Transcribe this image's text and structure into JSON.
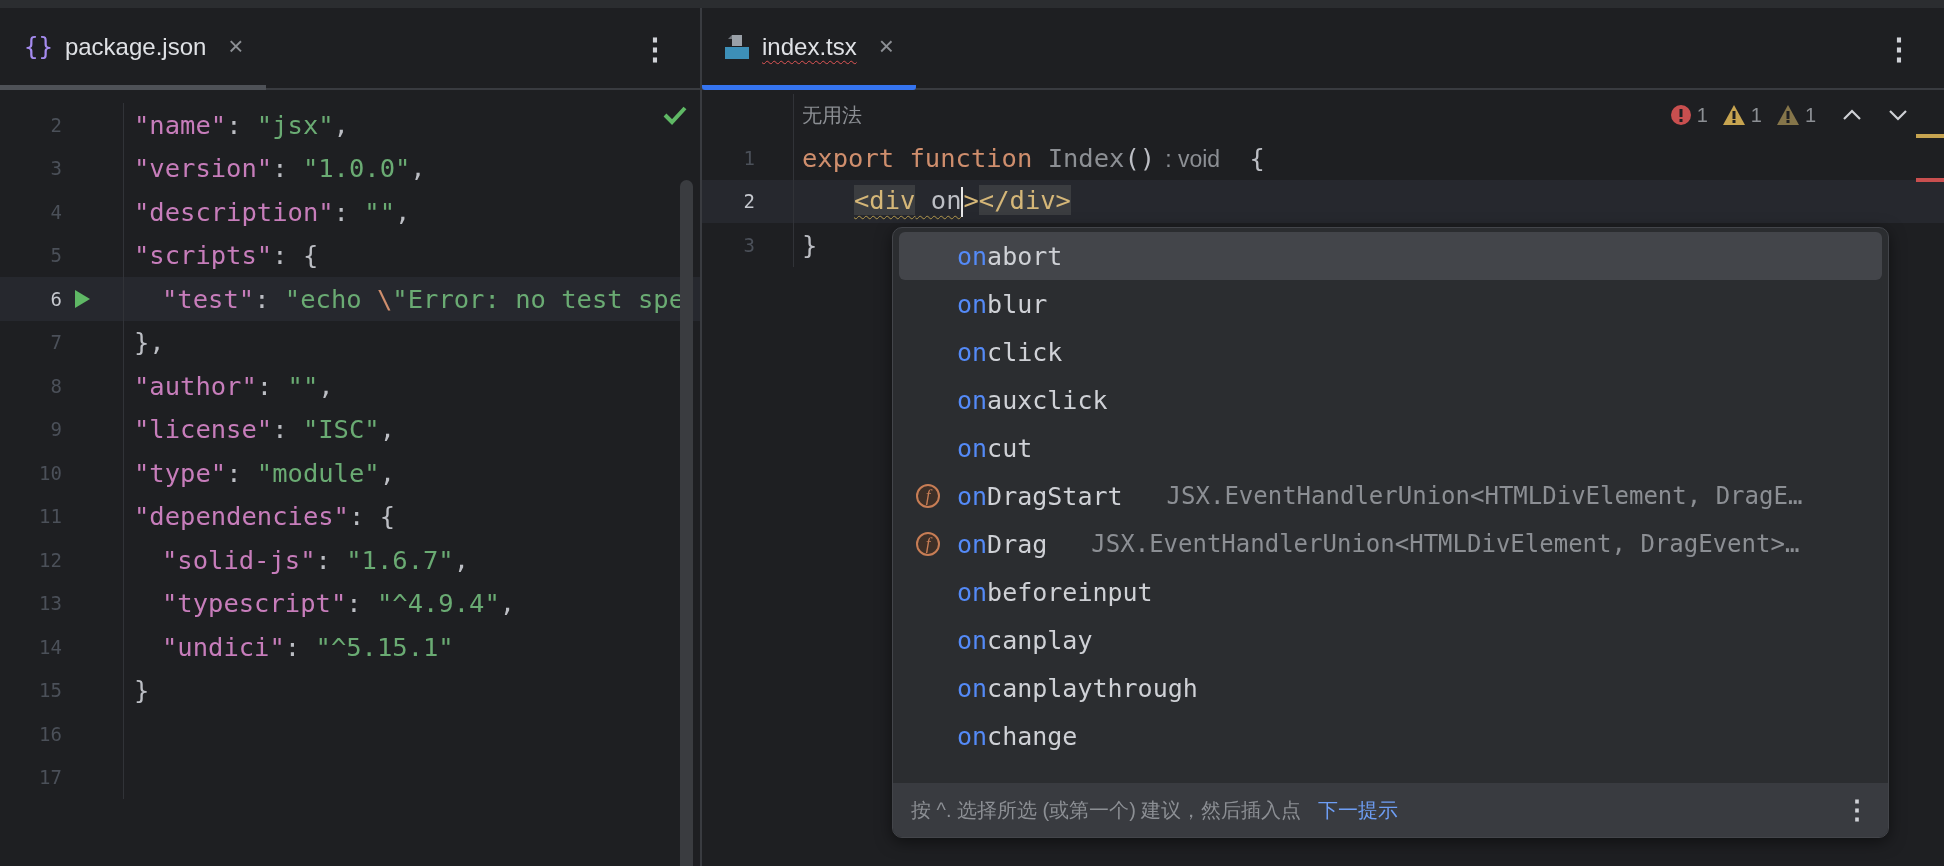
{
  "left_pane": {
    "tab": {
      "icon_text": "{}",
      "label": "package.json",
      "close": "×",
      "selected": false
    },
    "menu": "⋮",
    "lines": [
      {
        "number": "2",
        "current": false,
        "tokens": [
          {
            "kind": "key",
            "text": "\"name\""
          },
          {
            "kind": "punc",
            "text": ": "
          },
          {
            "kind": "str",
            "text": "\"jsx\""
          },
          {
            "kind": "punc",
            "text": ","
          }
        ]
      },
      {
        "number": "3",
        "current": false,
        "tokens": [
          {
            "kind": "key",
            "text": "\"version\""
          },
          {
            "kind": "punc",
            "text": ": "
          },
          {
            "kind": "str",
            "text": "\"1.0.0\""
          },
          {
            "kind": "punc",
            "text": ","
          }
        ]
      },
      {
        "number": "4",
        "current": false,
        "tokens": [
          {
            "kind": "key",
            "text": "\"description\""
          },
          {
            "kind": "punc",
            "text": ": "
          },
          {
            "kind": "str",
            "text": "\"\""
          },
          {
            "kind": "punc",
            "text": ","
          }
        ]
      },
      {
        "number": "5",
        "current": false,
        "tokens": [
          {
            "kind": "key",
            "text": "\"scripts\""
          },
          {
            "kind": "punc",
            "text": ": {"
          }
        ]
      },
      {
        "number": "6",
        "current": true,
        "runnable": true,
        "indented": true,
        "tokens": [
          {
            "kind": "key",
            "text": "\"test\""
          },
          {
            "kind": "punc",
            "text": ": "
          },
          {
            "kind": "str",
            "text": "\"echo "
          },
          {
            "kind": "esc",
            "text": "\\"
          },
          {
            "kind": "str",
            "text": "\"Error: no test spe"
          }
        ]
      },
      {
        "number": "7",
        "current": false,
        "tokens": [
          {
            "kind": "punc",
            "text": "},"
          }
        ]
      },
      {
        "number": "8",
        "current": false,
        "tokens": [
          {
            "kind": "key",
            "text": "\"author\""
          },
          {
            "kind": "punc",
            "text": ": "
          },
          {
            "kind": "str",
            "text": "\"\""
          },
          {
            "kind": "punc",
            "text": ","
          }
        ]
      },
      {
        "number": "9",
        "current": false,
        "tokens": [
          {
            "kind": "key",
            "text": "\"license\""
          },
          {
            "kind": "punc",
            "text": ": "
          },
          {
            "kind": "str",
            "text": "\"ISC\""
          },
          {
            "kind": "punc",
            "text": ","
          }
        ]
      },
      {
        "number": "10",
        "current": false,
        "tokens": [
          {
            "kind": "key",
            "text": "\"type\""
          },
          {
            "kind": "punc",
            "text": ": "
          },
          {
            "kind": "str",
            "text": "\"module\""
          },
          {
            "kind": "punc",
            "text": ","
          }
        ]
      },
      {
        "number": "11",
        "current": false,
        "tokens": [
          {
            "kind": "key",
            "text": "\"dependencies\""
          },
          {
            "kind": "punc",
            "text": ": {"
          }
        ]
      },
      {
        "number": "12",
        "current": false,
        "indented": true,
        "tokens": [
          {
            "kind": "key",
            "text": "\"solid-js\""
          },
          {
            "kind": "punc",
            "text": ": "
          },
          {
            "kind": "str",
            "text": "\"1.6.7\""
          },
          {
            "kind": "punc",
            "text": ","
          }
        ]
      },
      {
        "number": "13",
        "current": false,
        "indented": true,
        "tokens": [
          {
            "kind": "key",
            "text": "\"typescript\""
          },
          {
            "kind": "punc",
            "text": ": "
          },
          {
            "kind": "str",
            "text": "\"^4.9.4\""
          },
          {
            "kind": "punc",
            "text": ","
          }
        ]
      },
      {
        "number": "14",
        "current": false,
        "indented": true,
        "tokens": [
          {
            "kind": "key",
            "text": "\"undici\""
          },
          {
            "kind": "punc",
            "text": ": "
          },
          {
            "kind": "str",
            "text": "\"^5.15.1\""
          }
        ]
      },
      {
        "number": "15",
        "current": false,
        "tokens": [
          {
            "kind": "punc",
            "text": "}"
          }
        ]
      },
      {
        "number": "16",
        "current": false
      },
      {
        "number": "17",
        "current": false
      }
    ]
  },
  "right_pane": {
    "tab": {
      "label": "index.tsx",
      "close": "×",
      "selected": true,
      "has_error": true
    },
    "menu": "⋮",
    "usage_hint": "无用法",
    "problems": [
      {
        "kind": "error",
        "count": "1"
      },
      {
        "kind": "warning",
        "count": "1"
      },
      {
        "kind": "weak_warning",
        "count": "1"
      }
    ],
    "lines": [
      {
        "number": "1",
        "current": false,
        "tokens": [
          {
            "kind": "kw",
            "text": "export function "
          },
          {
            "kind": "unused",
            "text": "Index"
          },
          {
            "kind": "punc",
            "text": "()"
          },
          {
            "kind": "hint",
            "text": ": void"
          },
          {
            "kind": "punc",
            "text": " {"
          }
        ]
      },
      {
        "number": "2",
        "current": true,
        "indented": true,
        "tokens": [
          {
            "kind": "tag_match",
            "text": "<div",
            "squiggle": true
          },
          {
            "kind": "attr",
            "text": " on",
            "squiggle": true
          },
          {
            "kind": "caret"
          },
          {
            "kind": "tag",
            "text": ">"
          },
          {
            "kind": "tag_match",
            "text": "</div>"
          }
        ]
      },
      {
        "number": "3",
        "current": false,
        "tokens": [
          {
            "kind": "punc",
            "text": "}"
          }
        ]
      }
    ],
    "stripe_marks": [
      {
        "kind": "warning"
      },
      {
        "kind": "error"
      }
    ],
    "completion": {
      "items": [
        {
          "match": "on",
          "rest": "abort",
          "selected": true
        },
        {
          "match": "on",
          "rest": "blur",
          "selected": false
        },
        {
          "match": "on",
          "rest": "click",
          "selected": false
        },
        {
          "match": "on",
          "rest": "auxclick",
          "selected": false
        },
        {
          "match": "on",
          "rest": "cut",
          "selected": false
        },
        {
          "match": "on",
          "rest": "DragStart",
          "selected": false,
          "icon": "f",
          "type": "JSX.EventHandlerUnion<HTMLDivElement, DragE…"
        },
        {
          "match": "on",
          "rest": "Drag",
          "selected": false,
          "icon": "f",
          "type": "JSX.EventHandlerUnion<HTMLDivElement, DragEvent>…"
        },
        {
          "match": "on",
          "rest": "beforeinput",
          "selected": false
        },
        {
          "match": "on",
          "rest": "canplay",
          "selected": false
        },
        {
          "match": "on",
          "rest": "canplaythrough",
          "selected": false
        },
        {
          "match": "on",
          "rest": "change",
          "selected": false
        }
      ],
      "footer": {
        "text": "按 ^. 选择所选 (或第一个) 建议，然后插入点",
        "link": "下一提示",
        "menu": "⋮"
      }
    }
  }
}
